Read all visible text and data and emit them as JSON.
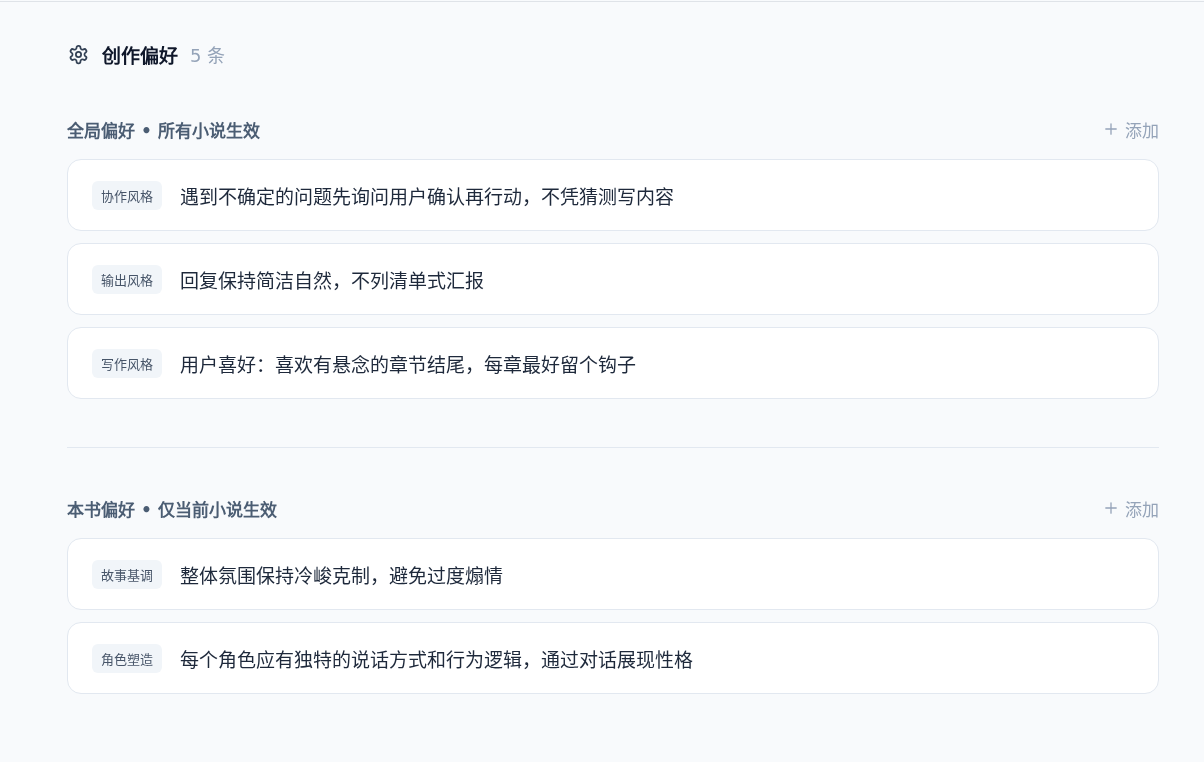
{
  "header": {
    "title": "创作偏好",
    "count": "5 条"
  },
  "sections": [
    {
      "title": "全局偏好 • 所有小说生效",
      "add_button": "添加",
      "items": [
        {
          "tag": "协作风格",
          "text": "遇到不确定的问题先询问用户确认再行动，不凭猜测写内容"
        },
        {
          "tag": "输出风格",
          "text": "回复保持简洁自然，不列清单式汇报"
        },
        {
          "tag": "写作风格",
          "text": "用户喜好：喜欢有悬念的章节结尾，每章最好留个钩子"
        }
      ]
    },
    {
      "title": "本书偏好 • 仅当前小说生效",
      "add_button": "添加",
      "items": [
        {
          "tag": "故事基调",
          "text": "整体氛围保持冷峻克制，避免过度煽情"
        },
        {
          "tag": "角色塑造",
          "text": "每个角色应有独特的说话方式和行为逻辑，通过对话展现性格"
        }
      ]
    }
  ]
}
